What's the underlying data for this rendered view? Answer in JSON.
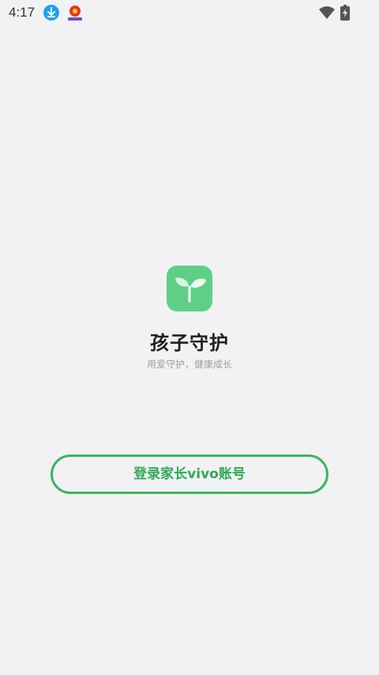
{
  "status_bar": {
    "time": "4:17",
    "icons": [
      "download-icon",
      "app-notification-icon",
      "wifi-icon",
      "battery-charging-icon"
    ]
  },
  "app": {
    "logo_icon": "sprout-icon",
    "title": "孩子守护",
    "subtitle": "用爱守护，健康成长"
  },
  "login_button": {
    "label": "登录家长vivo账号"
  },
  "colors": {
    "background": "#f2f2f4",
    "accent": "#3ab662",
    "logo": "#5fcf86"
  }
}
